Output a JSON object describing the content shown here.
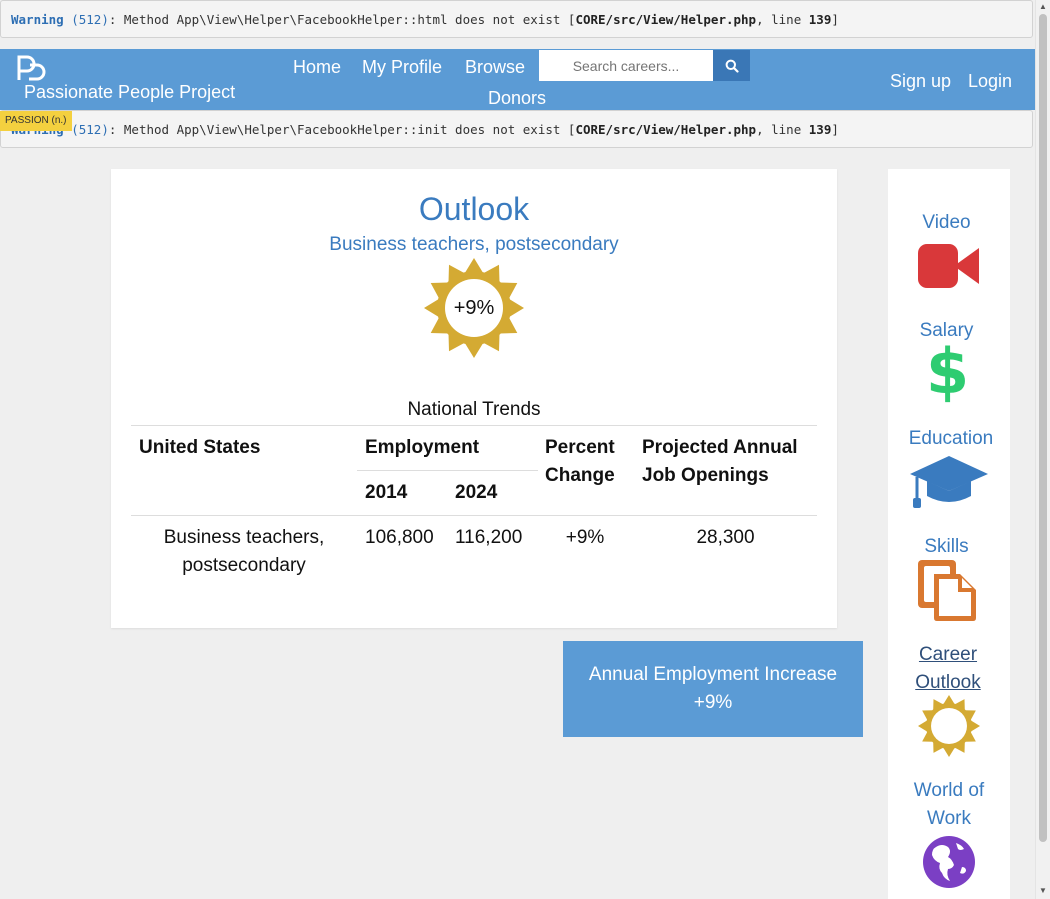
{
  "warnings": [
    {
      "label": "Warning",
      "code": "(512)",
      "text": ": Method App\\View\\Helper\\FacebookHelper::html does not exist [",
      "file": "CORE/src/View/Helper.php",
      "line_text": ", line ",
      "line": "139",
      "close": "]"
    },
    {
      "label": "Warning",
      "code": "(512)",
      "text": ": Method App\\View\\Helper\\FacebookHelper::init does not exist [",
      "file": "CORE/src/View/Helper.php",
      "line_text": ", line ",
      "line": "139",
      "close": "]"
    }
  ],
  "navbar": {
    "brand": "Passionate People Project",
    "links": [
      "Home",
      "My Profile",
      "Browse",
      "Donors"
    ],
    "search_placeholder": "Search careers...",
    "right_links": [
      "Sign up",
      "Login"
    ],
    "badge": "PASSION (n.)",
    "bg_color": "#5b9bd5"
  },
  "outlook": {
    "title": "Outlook",
    "subtitle": "Business teachers, postsecondary",
    "sun_value": "+9%",
    "sun_color": "#d4aa33"
  },
  "trends": {
    "caption": "National Trends",
    "headers": {
      "region": "United States",
      "employment": "Employment",
      "year1": "2014",
      "year2": "2024",
      "percent_line1": "Percent",
      "percent_line2": "Change",
      "openings_line1": "Projected Annual",
      "openings_line2": "Job Openings"
    },
    "row": {
      "occupation_line1": "Business teachers,",
      "occupation_line2": "postsecondary",
      "emp_2014": "106,800",
      "emp_2024": "116,200",
      "percent_change": "+9%",
      "openings": "28,300"
    }
  },
  "increase_card": {
    "label": "Annual Employment Increase",
    "value": "+9%"
  },
  "sidebar": {
    "items": [
      {
        "label": "Video",
        "icon": "video-camera-icon",
        "color": "#d9383a"
      },
      {
        "label": "Salary",
        "icon": "dollar-icon",
        "color": "#2ecc71"
      },
      {
        "label": "Education",
        "icon": "graduation-cap-icon",
        "color": "#3a7bbf"
      },
      {
        "label": "Skills",
        "icon": "documents-icon",
        "color": "#d97830"
      },
      {
        "label_line1": "Career",
        "label_line2": "Outlook",
        "icon": "sun-icon",
        "color": "#d4aa33",
        "active": true
      },
      {
        "label_line1": "World of",
        "label_line2": "Work",
        "icon": "globe-icon",
        "color": "#7b3fc4"
      }
    ]
  }
}
